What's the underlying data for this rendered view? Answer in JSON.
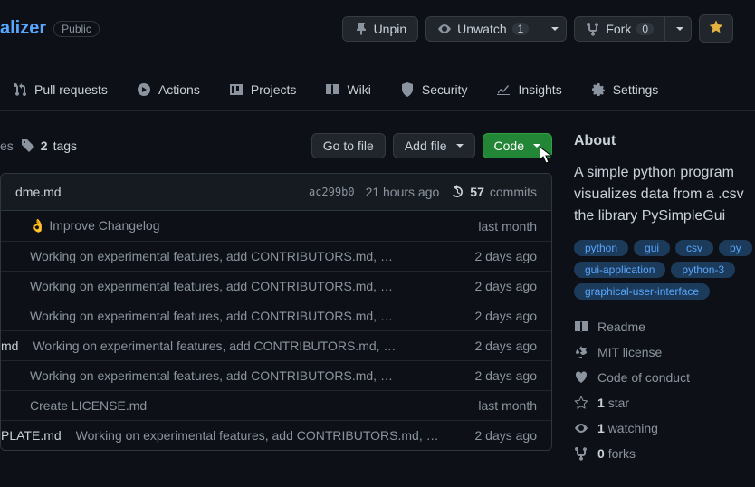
{
  "header": {
    "repo_name_fragment": "alizer",
    "visibility": "Public",
    "unpin": "Unpin",
    "unwatch": "Unwatch",
    "watch_count": "1",
    "fork": "Fork",
    "fork_count": "0"
  },
  "tabs": {
    "pull_requests": "Pull requests",
    "actions": "Actions",
    "projects": "Projects",
    "wiki": "Wiki",
    "security": "Security",
    "insights": "Insights",
    "settings": "Settings"
  },
  "file_bar": {
    "branches_fragment": "es",
    "tags_count": "2",
    "tags_label": "tags",
    "go_to_file": "Go to file",
    "add_file": "Add file",
    "code": "Code"
  },
  "commit_head": {
    "filename": "dme.md",
    "sha": "ac299b0",
    "relative": "21 hours ago",
    "commits_count": "57",
    "commits_label": "commits"
  },
  "rows": [
    {
      "filename": "",
      "msg": "👌 Improve Changelog",
      "time": "last month"
    },
    {
      "filename": "",
      "msg": "Working on experimental features, add CONTRIBUTORS.md, …",
      "time": "2 days ago"
    },
    {
      "filename": "",
      "msg": "Working on experimental features, add CONTRIBUTORS.md, …",
      "time": "2 days ago"
    },
    {
      "filename": "",
      "msg": "Working on experimental features, add CONTRIBUTORS.md, …",
      "time": "2 days ago"
    },
    {
      "filename": "md",
      "msg": "Working on experimental features, add CONTRIBUTORS.md, …",
      "time": "2 days ago"
    },
    {
      "filename": "",
      "msg": "Working on experimental features, add CONTRIBUTORS.md, …",
      "time": "2 days ago"
    },
    {
      "filename": "",
      "msg": "Create LICENSE.md",
      "time": "last month"
    },
    {
      "filename": "PLATE.md",
      "msg": "Working on experimental features, add CONTRIBUTORS.md, …",
      "time": "2 days ago"
    }
  ],
  "about": {
    "title": "About",
    "description": "A simple python program visualizes data from a .csv the library PySimpleGui",
    "topics": [
      "python",
      "gui",
      "csv",
      "py",
      "gui-application",
      "python-3",
      "graphical-user-interface"
    ],
    "readme": "Readme",
    "license": "MIT license",
    "coc": "Code of conduct",
    "stars_count": "1",
    "stars_label": "star",
    "watching_count": "1",
    "watching_label": "watching",
    "forks_count": "0",
    "forks_label": "forks"
  }
}
